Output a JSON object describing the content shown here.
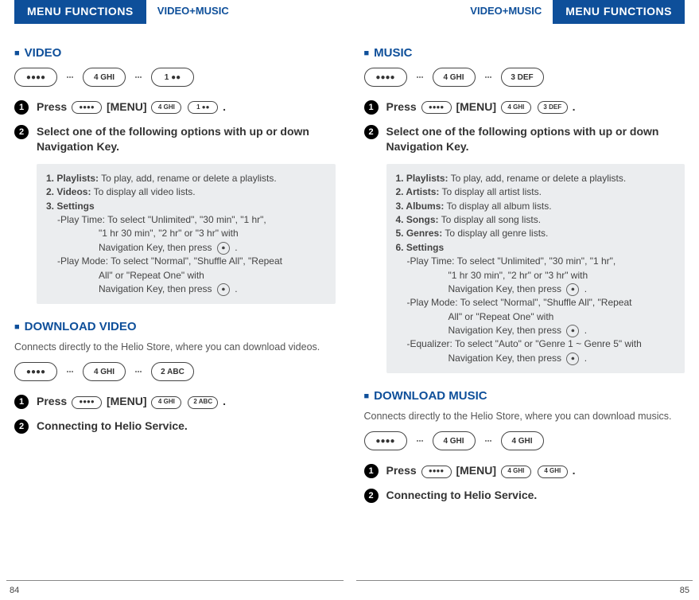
{
  "left": {
    "tab": "MENU FUNCTIONS",
    "chapter": "VIDEO+MUSIC",
    "page": "84",
    "sections": {
      "video": {
        "title": "VIDEO",
        "keys": [
          "●●●●",
          "4 GHI",
          "1 ●●"
        ],
        "step1a": "Press",
        "step1b": "[MENU]",
        "step1c": ".",
        "step2": "Select one of the following options with up or down Navigation Key.",
        "opts": {
          "l1": "1. Playlists:",
          "t1": " To play, add, rename or delete a playlists.",
          "l2": "2. Videos:",
          "t2": " To display all video lists.",
          "l3": "3. Settings",
          "pt_label": "-Play Time:",
          "pt_text1": " To select \"Unlimited\", \"30 min\", \"1 hr\",",
          "pt_text2": "\"1 hr 30 min\", \"2 hr\" or \"3 hr\" with",
          "pt_text3": "Navigation Key, then press ",
          "pm_label": "-Play Mode:",
          "pm_text1": " To select \"Normal\", \"Shuffle All\", \"Repeat",
          "pm_text2": "All\" or \"Repeat One\" with",
          "pm_text3": "Navigation Key, then press "
        }
      },
      "dlvideo": {
        "title": "DOWNLOAD VIDEO",
        "sub": "Connects directly to the Helio Store, where you can download videos.",
        "keys": [
          "●●●●",
          "4 GHI",
          "2 ABC"
        ],
        "step1a": "Press",
        "step1b": "[MENU]",
        "step1c": ".",
        "step2": "Connecting to Helio Service."
      }
    }
  },
  "right": {
    "tab": "MENU FUNCTIONS",
    "chapter": "VIDEO+MUSIC",
    "page": "85",
    "sections": {
      "music": {
        "title": "MUSIC",
        "keys": [
          "●●●●",
          "4 GHI",
          "3 DEF"
        ],
        "step1a": "Press",
        "step1b": "[MENU]",
        "step1c": ".",
        "step2": "Select one of the following options with up or down Navigation Key.",
        "opts": {
          "l1": "1. Playlists:",
          "t1": " To play, add, rename or delete a playlists.",
          "l2": "2. Artists:",
          "t2": " To display all artist lists.",
          "l3": "3. Albums:",
          "t3": " To display all album lists.",
          "l4": "4. Songs:",
          "t4": " To display all song lists.",
          "l5": "5. Genres:",
          "t5": " To display all genre lists.",
          "l6": "6. Settings",
          "pt_label": "-Play Time:",
          "pt_text1": " To select \"Unlimited\", \"30 min\", \"1 hr\",",
          "pt_text2": "\"1 hr 30 min\", \"2 hr\" or \"3 hr\" with",
          "pt_text3": "Navigation Key, then press ",
          "pm_label": "-Play Mode:",
          "pm_text1": " To select \"Normal\", \"Shuffle All\", \"Repeat",
          "pm_text2": "All\" or \"Repeat One\" with",
          "pm_text3": "Navigation Key, then press ",
          "eq_label": "-Equalizer:",
          "eq_text1": " To select \"Auto\" or \"Genre 1 ~ Genre 5\" with",
          "eq_text2": "Navigation Key, then press "
        }
      },
      "dlmusic": {
        "title": "DOWNLOAD MUSIC",
        "sub": "Connects directly to the Helio Store, where you can download musics.",
        "keys": [
          "●●●●",
          "4 GHI",
          "4 GHI"
        ],
        "step1a": "Press",
        "step1b": "[MENU]",
        "step1c": ".",
        "step2": "Connecting to Helio Service."
      }
    }
  },
  "ok_glyph": "⏺"
}
